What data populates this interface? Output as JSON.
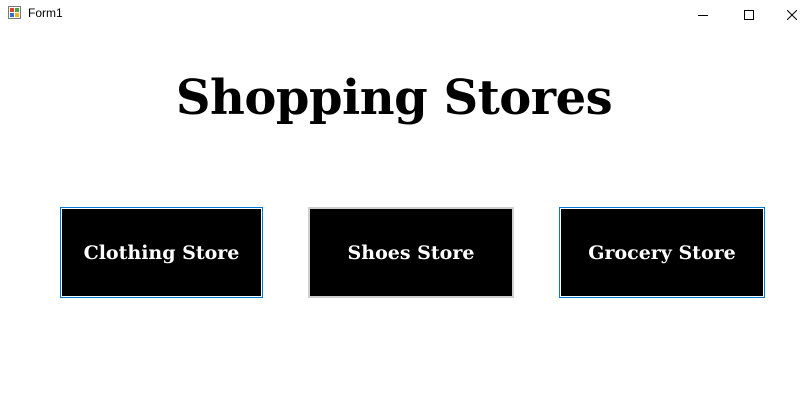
{
  "window": {
    "title": "Form1",
    "icon": "winforms-app-icon",
    "controls": {
      "minimize_icon": "minimize-icon",
      "maximize_icon": "maximize-icon",
      "close_icon": "close-icon"
    }
  },
  "main": {
    "heading": "Shopping Stores",
    "buttons": {
      "clothing": "Clothing Store",
      "shoes": "Shoes Store",
      "grocery": "Grocery Store"
    }
  },
  "colors": {
    "button_background": "#000000",
    "button_text": "#ffffff",
    "focus_border": "#0078d7",
    "page_background": "#ffffff"
  }
}
